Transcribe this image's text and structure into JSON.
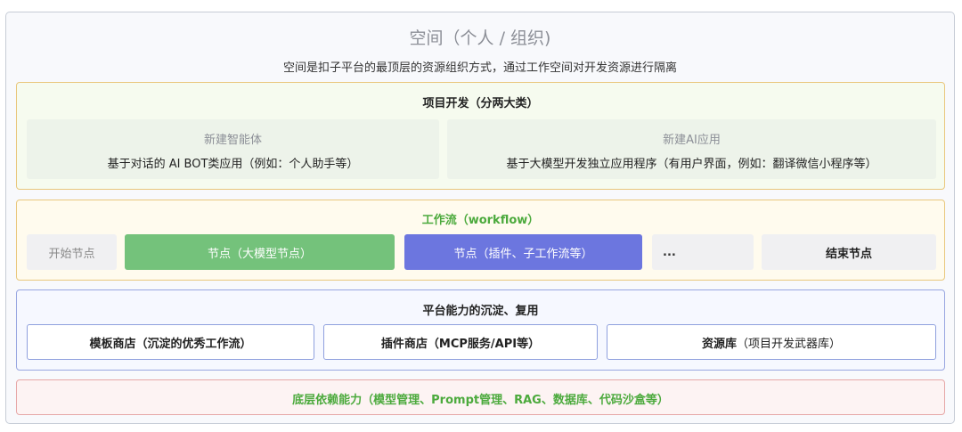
{
  "space": {
    "title": "空间（个人 / 组织)",
    "subtitle": "空间是扣子平台的最顶层的资源组织方式，通过工作空间对开发资源进行隔离"
  },
  "project": {
    "heading": "项目开发（分两大类）",
    "cards": [
      {
        "title": "新建智能体",
        "desc": "基于对话的 AI BOT类应用（例如：个人助手等）"
      },
      {
        "title": "新建AI应用",
        "desc": "基于大模型开发独立应用程序（有用户界面，例如：翻译微信小程序等）"
      }
    ]
  },
  "workflow": {
    "heading": "工作流（workflow）",
    "nodes": [
      "开始节点",
      "节点（大模型节点）",
      "节点（插件、子工作流等）",
      "...",
      "结束节点"
    ]
  },
  "platform": {
    "heading": "平台能力的沉淀、复用",
    "items": [
      {
        "label": "模板商店（沉淀的优秀工作流）"
      },
      {
        "label": "插件商店（MCP服务/API等）"
      },
      {
        "label": "资源库",
        "suffix": "（项目开发武器库）"
      }
    ]
  },
  "base": {
    "text": "底层依赖能力（模型管理、Prompt管理、RAG、数据库、代码沙盒等）"
  },
  "colors": {
    "llm_node": "#74c27b",
    "plugin_node": "#6c76df",
    "base_text": "#4caa3d"
  }
}
